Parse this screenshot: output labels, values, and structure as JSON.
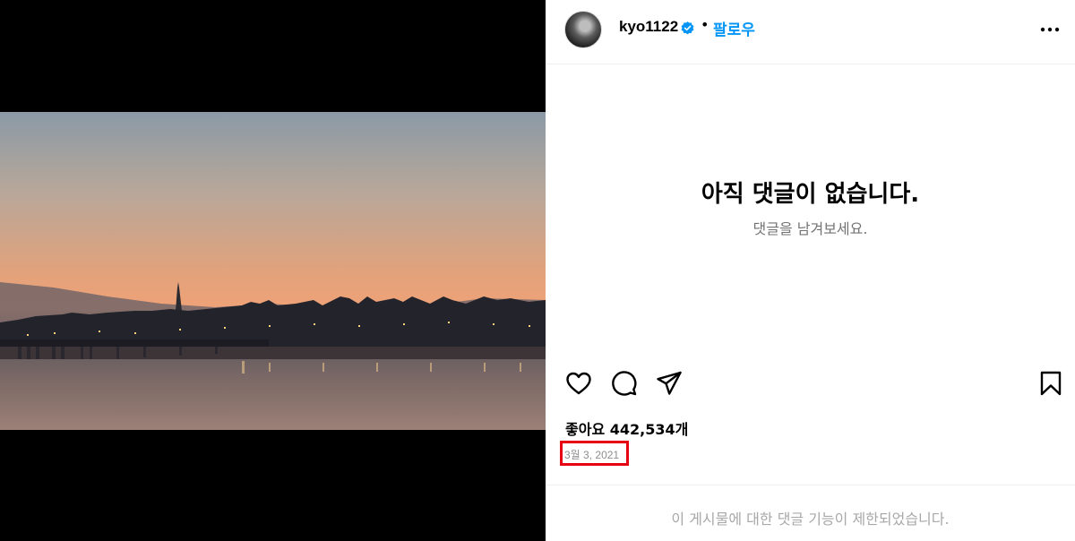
{
  "post": {
    "username": "kyo1122",
    "separator": "•",
    "follow_label": "팔로우",
    "comments_empty_title": "아직 댓글이 없습니다.",
    "comments_empty_subtitle": "댓글을 남겨보세요.",
    "likes_text": "좋아요 442,534개",
    "date": "3월 3, 2021",
    "comments_restricted": "이 게시물에 대한 댓글 기능이 제한되었습니다."
  },
  "icons": {
    "verified": "verified-badge-icon",
    "more": "more-options-icon",
    "like": "heart-icon",
    "comment": "comment-icon",
    "share": "share-icon",
    "save": "bookmark-icon"
  },
  "colors": {
    "follow": "#0095f6",
    "highlight_box": "#e60012",
    "muted_text": "#737373"
  }
}
